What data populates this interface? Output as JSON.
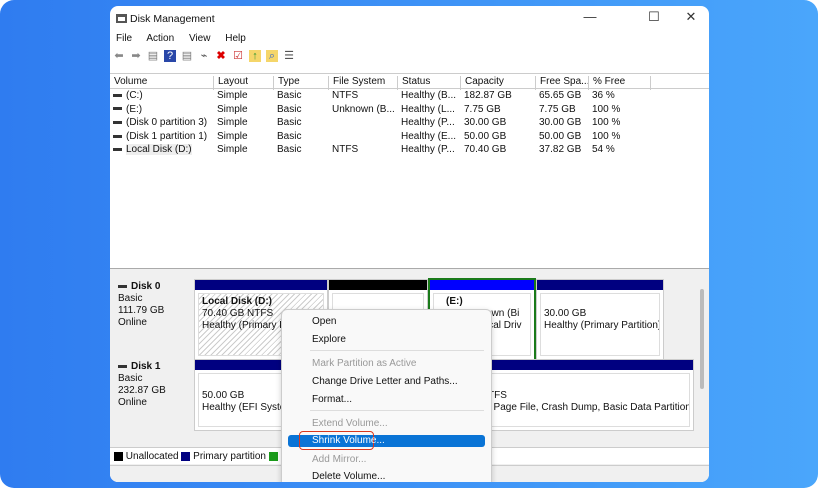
{
  "window": {
    "title": "Disk Management"
  },
  "menu": [
    "File",
    "Action",
    "View",
    "Help"
  ],
  "columns": [
    "Volume",
    "Layout",
    "Type",
    "File System",
    "Status",
    "Capacity",
    "Free Spa...",
    "% Free"
  ],
  "volumes": [
    [
      "(C:)",
      "Simple",
      "Basic",
      "NTFS",
      "Healthy (B...",
      "182.87 GB",
      "65.65 GB",
      "36 %"
    ],
    [
      "(E:)",
      "Simple",
      "Basic",
      "Unknown (B...",
      "Healthy (L...",
      "7.75 GB",
      "7.75 GB",
      "100 %"
    ],
    [
      "(Disk 0 partition 3)",
      "Simple",
      "Basic",
      "",
      "Healthy (P...",
      "30.00 GB",
      "30.00 GB",
      "100 %"
    ],
    [
      "(Disk 1 partition 1)",
      "Simple",
      "Basic",
      "",
      "Healthy (E...",
      "50.00 GB",
      "50.00 GB",
      "100 %"
    ],
    [
      "Local Disk (D:)",
      "Simple",
      "Basic",
      "NTFS",
      "Healthy (P...",
      "70.40 GB",
      "37.82 GB",
      "54 %"
    ]
  ],
  "disks": [
    {
      "name": "Disk 0",
      "type": "Basic",
      "size": "111.79 GB",
      "state": "Online"
    },
    {
      "name": "Disk 1",
      "type": "Basic",
      "size": "232.87 GB",
      "state": "Online"
    }
  ],
  "parts": {
    "d": {
      "name": "Local Disk  (D:)",
      "size": "70.40 GB NTFS",
      "status": "Healthy (Primary Pa"
    },
    "e": {
      "name": "(E:)",
      "fs": "own (Bi",
      "status": "ical Driv"
    },
    "p3": {
      "size": "30.00 GB",
      "status": "Healthy (Primary Partition)"
    },
    "efi": {
      "size": "50.00 GB",
      "status": "Healthy (EFI System"
    },
    "c": {
      "size": "TFS",
      "status": "; Page File, Crash Dump, Basic Data Partition)"
    }
  },
  "legend": [
    "Unallocated",
    "Primary partition"
  ],
  "context_menu": {
    "open": "Open",
    "explore": "Explore",
    "mark": "Mark Partition as Active",
    "change": "Change Drive Letter and Paths...",
    "format": "Format...",
    "extend": "Extend Volume...",
    "shrink": "Shrink Volume...",
    "mirror": "Add Mirror...",
    "delete": "Delete Volume..."
  },
  "colors": {
    "primary": "#000080",
    "unallocated": "#000000",
    "logical": "#0000ff",
    "highlight": "#0a74d6",
    "annotation": "#d9381e"
  }
}
